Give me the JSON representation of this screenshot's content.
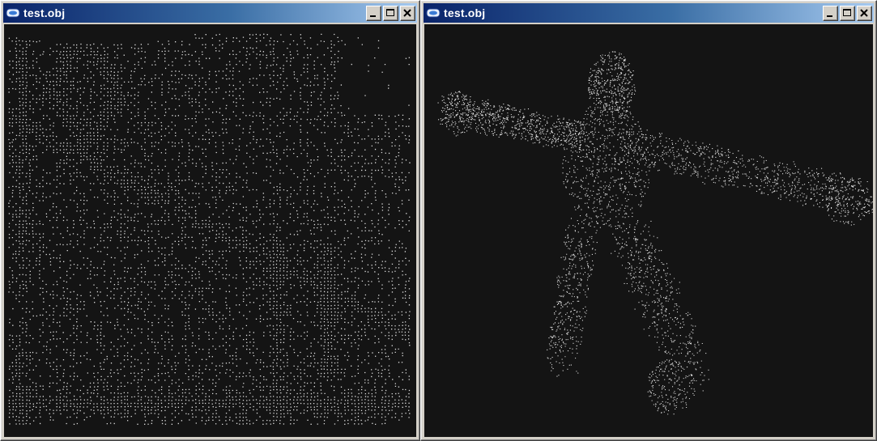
{
  "windows": [
    {
      "title": "test.obj",
      "icon": "app-window-icon",
      "buttons": [
        "minimize-icon",
        "maximize-icon",
        "close-icon"
      ],
      "content": "point-cloud-room"
    },
    {
      "title": "test.obj",
      "icon": "app-window-icon",
      "buttons": [
        "minimize-icon",
        "maximize-icon",
        "close-icon"
      ],
      "content": "point-cloud-figure"
    }
  ],
  "colors": {
    "title_gradient_start": "#0a246a",
    "title_gradient_end": "#a6caf0",
    "viewport_bg": "#141414",
    "point_color": "#e0e0e0"
  }
}
